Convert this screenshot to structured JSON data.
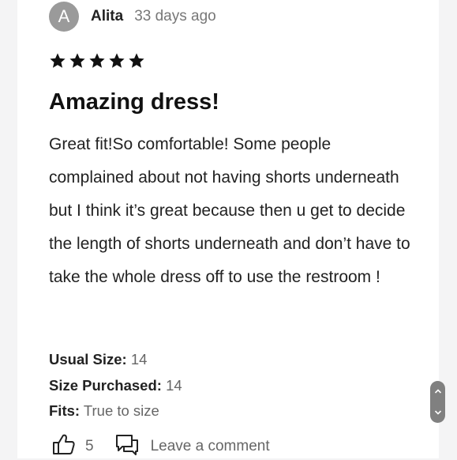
{
  "review": {
    "avatar_initial": "A",
    "author": "Alita",
    "date": "33 days ago",
    "rating": 5,
    "title": "Amazing dress!",
    "body": "Great fit!So comfortable! Some people complained about not having shorts underneath but I think it’s great because then u get to decide the length of shorts underneath and don’t have to take the whole dress off to use the restroom !",
    "details": [
      {
        "label": "Usual Size:",
        "value": "14"
      },
      {
        "label": "Size Purchased:",
        "value": "14"
      },
      {
        "label": "Fits:",
        "value": "True to size"
      }
    ],
    "likes": "5",
    "comment_label": "Leave a comment"
  },
  "icons": {
    "star": "star-icon",
    "like": "thumbs-up-icon",
    "comment": "comment-icon",
    "scroll_up": "chevron-up-icon",
    "scroll_down": "chevron-down-icon"
  },
  "colors": {
    "avatar_bg": "#9a9a9a",
    "star": "#111111",
    "muted_text": "#777777",
    "scroll_button": "#808080"
  }
}
